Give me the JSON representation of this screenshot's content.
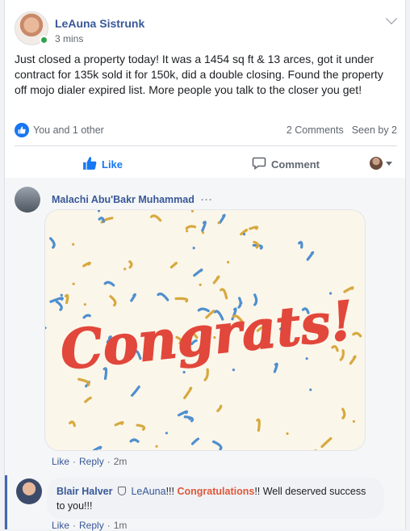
{
  "post": {
    "author": "LeAuna Sistrunk",
    "time": "3 mins",
    "text": "Just closed a property today! It was a 1454 sq ft & 13 arces, got it under contract for 135k sold it for 150k, did a double closing. Found the property off mojo dialer expired list. More people you talk to the closer you get!",
    "reactions_text": "You and 1 other",
    "comments_count": "2 Comments",
    "seen_by": "Seen by 2"
  },
  "actions": {
    "like": "Like",
    "comment": "Comment"
  },
  "comments": [
    {
      "author": "Malachi Abu'Bakr Muhammad",
      "dots": "···",
      "gif_text": "Congrats!",
      "like": "Like",
      "reply": "Reply",
      "time": "2m"
    },
    {
      "author": "Blair Halver",
      "tag": "LeAuna",
      "t1": "!!!",
      "highlight": "Congratulations",
      "t2": "!! Well deserved success to you!!!",
      "like": "Like",
      "reply": "Reply",
      "time": "1m"
    }
  ],
  "colors": {
    "link": "#385898",
    "accent": "#1877f2",
    "congrats_red": "#e2473b",
    "confetti_blue": "#4f8fcf",
    "confetti_gold": "#d7a93f"
  }
}
